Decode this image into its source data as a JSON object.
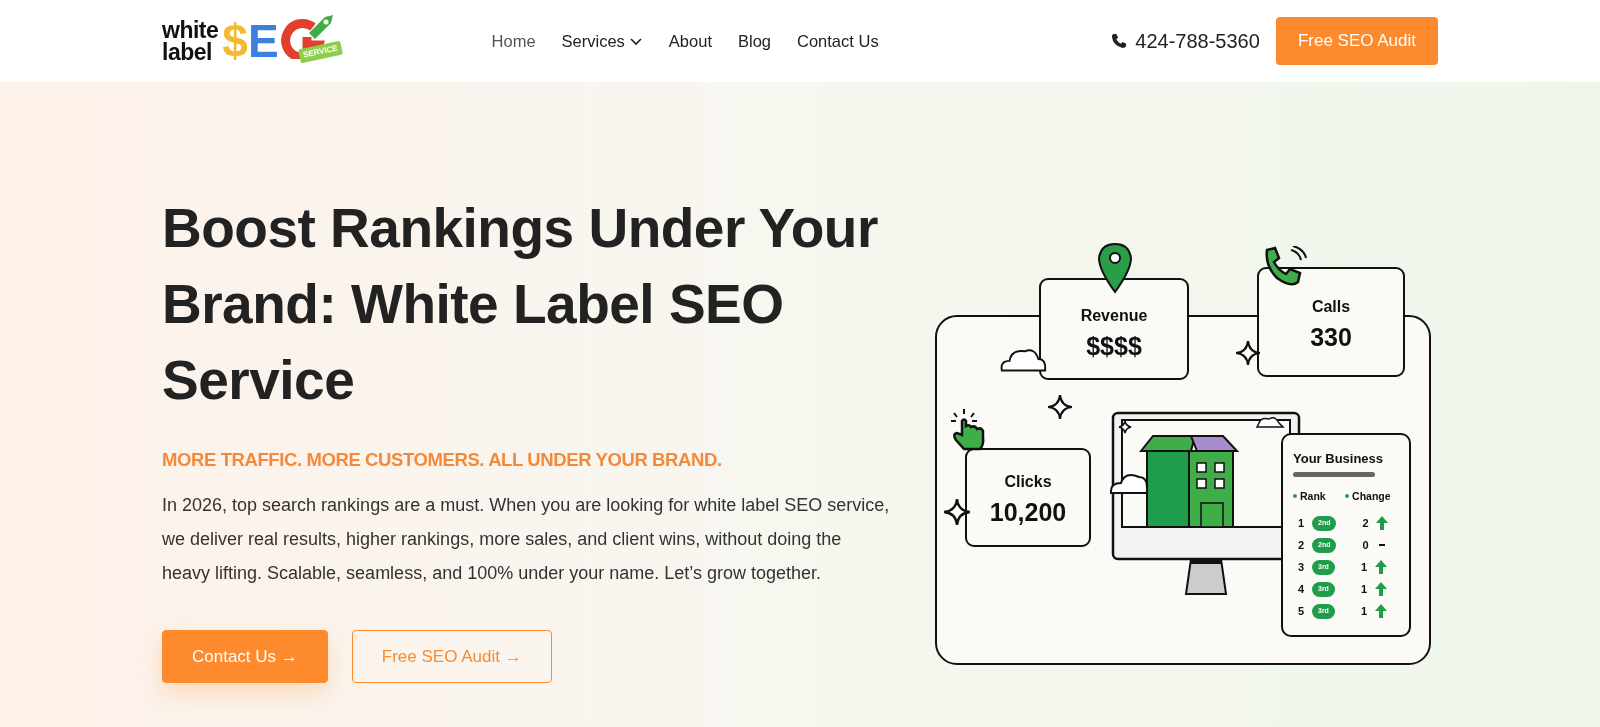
{
  "navbar": {
    "logo": {
      "words": [
        "white",
        "label"
      ],
      "letters": [
        "$",
        "E"
      ],
      "tag": "SERVICE"
    },
    "links": [
      {
        "label": "Home",
        "selected": true,
        "dropdown": false
      },
      {
        "label": "Services",
        "selected": false,
        "dropdown": true
      },
      {
        "label": "About",
        "selected": false,
        "dropdown": false
      },
      {
        "label": "Blog",
        "selected": false,
        "dropdown": false
      },
      {
        "label": "Contact Us",
        "selected": false,
        "dropdown": false
      }
    ],
    "phone": "424-788-5360",
    "cta": "Free SEO Audit"
  },
  "hero": {
    "heading": "Boost Rankings Under Your Brand: White Label SEO Service",
    "tagline": "MORE TRAFFIC. MORE CUSTOMERS. ALL UNDER YOUR BRAND.",
    "paragraph": "In 2026, top search rankings are a must. When you are looking for white label SEO service, we deliver real results, higher rankings, more sales, and client wins, without doing the heavy lifting. Scalable, seamless, and 100% under your name. Let’s grow together.",
    "buttons": [
      {
        "label": "Contact Us →",
        "kind": "primary"
      },
      {
        "label": "Free SEO Audit →",
        "kind": "outline"
      }
    ]
  },
  "illustration": {
    "revenue": {
      "label": "Revenue",
      "value": "$$$$"
    },
    "calls": {
      "label": "Calls",
      "value": "330"
    },
    "clicks": {
      "label": "Clicks",
      "value": "10,200"
    },
    "business": {
      "title": "Your Business",
      "columns": [
        "Rank",
        "Change"
      ],
      "rows": [
        {
          "rank": "1",
          "badge": "2nd",
          "change": "2",
          "rising": true
        },
        {
          "rank": "2",
          "badge": "2nd",
          "change": "0",
          "rising": false
        },
        {
          "rank": "3",
          "badge": "3rd",
          "change": "1",
          "rising": true
        },
        {
          "rank": "4",
          "badge": "3rd",
          "change": "1",
          "rising": true
        },
        {
          "rank": "5",
          "badge": "3rd",
          "change": "1",
          "rising": true
        }
      ]
    }
  }
}
